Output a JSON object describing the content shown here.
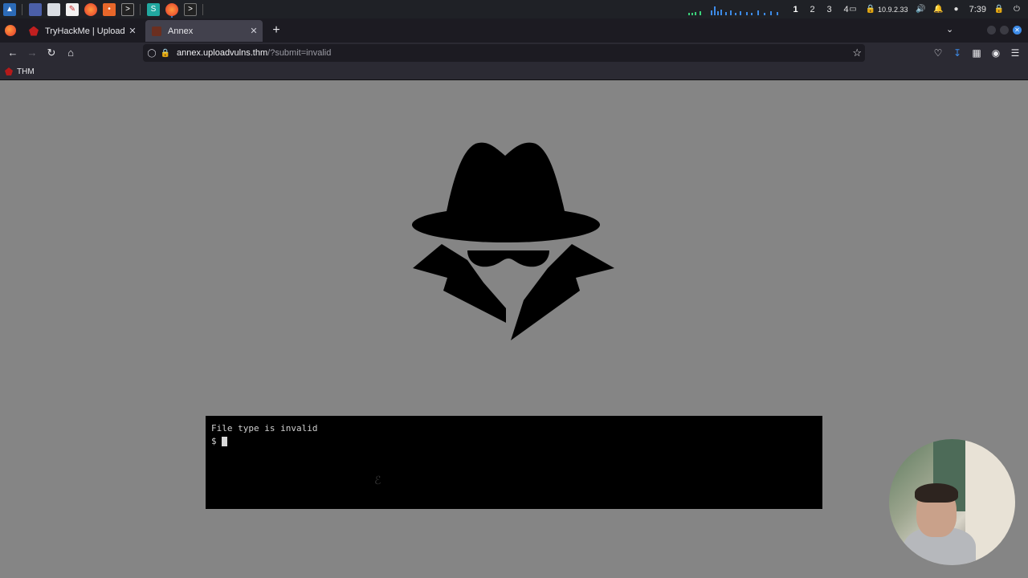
{
  "os_panel": {
    "workspaces": [
      "1",
      "2",
      "3",
      "4"
    ],
    "active_workspace": "1",
    "vpn_ip": "10.9.2.33",
    "clock": "7:39"
  },
  "browser": {
    "tabs": [
      {
        "title": "TryHackMe | Upload Vuln",
        "active": false
      },
      {
        "title": "Annex",
        "active": true
      }
    ],
    "url": {
      "host": "annex.uploadvulns.thm",
      "path": "/?submit=invalid"
    },
    "bookmarks": [
      {
        "label": "THM"
      }
    ]
  },
  "page": {
    "terminal": {
      "message": "File type is invalid",
      "prompt": "$"
    }
  },
  "colors": {
    "page_background": "#858585",
    "terminal_background": "#000000",
    "accent_blue": "#3d8be8"
  }
}
